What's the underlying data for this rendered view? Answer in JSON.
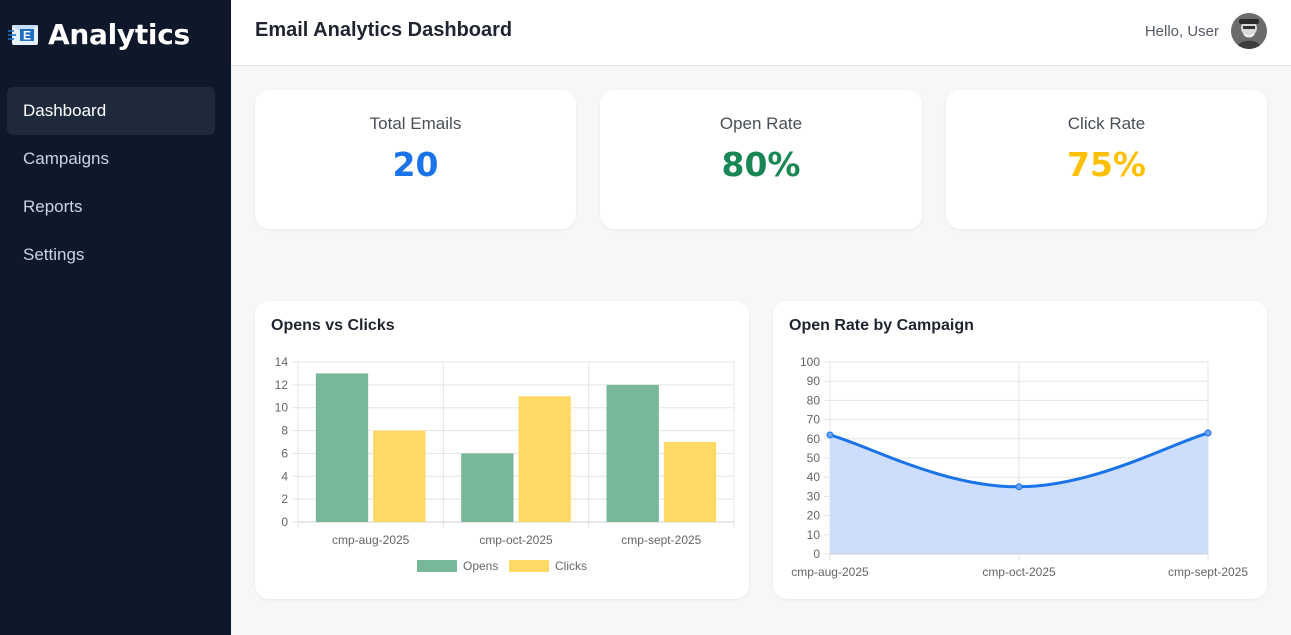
{
  "sidebar": {
    "brand": "Analytics",
    "brand_icon": "email-icon",
    "items": [
      {
        "label": "Dashboard",
        "active": true
      },
      {
        "label": "Campaigns",
        "active": false
      },
      {
        "label": "Reports",
        "active": false
      },
      {
        "label": "Settings",
        "active": false
      }
    ]
  },
  "header": {
    "title": "Email Analytics Dashboard",
    "greeting": "Hello, User",
    "avatar_icon": "user-avatar"
  },
  "stats": [
    {
      "label": "Total Emails",
      "value": "20",
      "color": "#1a73e8"
    },
    {
      "label": "Open Rate",
      "value": "80%",
      "color": "#198754"
    },
    {
      "label": "Click Rate",
      "value": "75%",
      "color": "#ffc107"
    }
  ],
  "colors": {
    "sidebar_bg": "#0f172a",
    "opens": "#79b799",
    "clicks": "#ffd966",
    "line": "#1a73e8",
    "area": "#c9dcfb"
  },
  "chart_data": [
    {
      "type": "bar",
      "title": "Opens vs Clicks",
      "categories": [
        "cmp-aug-2025",
        "cmp-oct-2025",
        "cmp-sept-2025"
      ],
      "series": [
        {
          "name": "Opens",
          "values": [
            13,
            6,
            12
          ]
        },
        {
          "name": "Clicks",
          "values": [
            8,
            11,
            7
          ]
        }
      ],
      "ylim": [
        0,
        14
      ],
      "yticks": [
        0,
        2,
        4,
        6,
        8,
        10,
        12,
        14
      ],
      "grid": true,
      "legend": "bottom"
    },
    {
      "type": "area",
      "title": "Open Rate by Campaign",
      "categories": [
        "cmp-aug-2025",
        "cmp-oct-2025",
        "cmp-sept-2025"
      ],
      "values": [
        62,
        35,
        63
      ],
      "ylim": [
        0,
        100
      ],
      "yticks": [
        0,
        10,
        20,
        30,
        40,
        50,
        60,
        70,
        80,
        90,
        100
      ],
      "grid": true,
      "smooth": true
    }
  ]
}
